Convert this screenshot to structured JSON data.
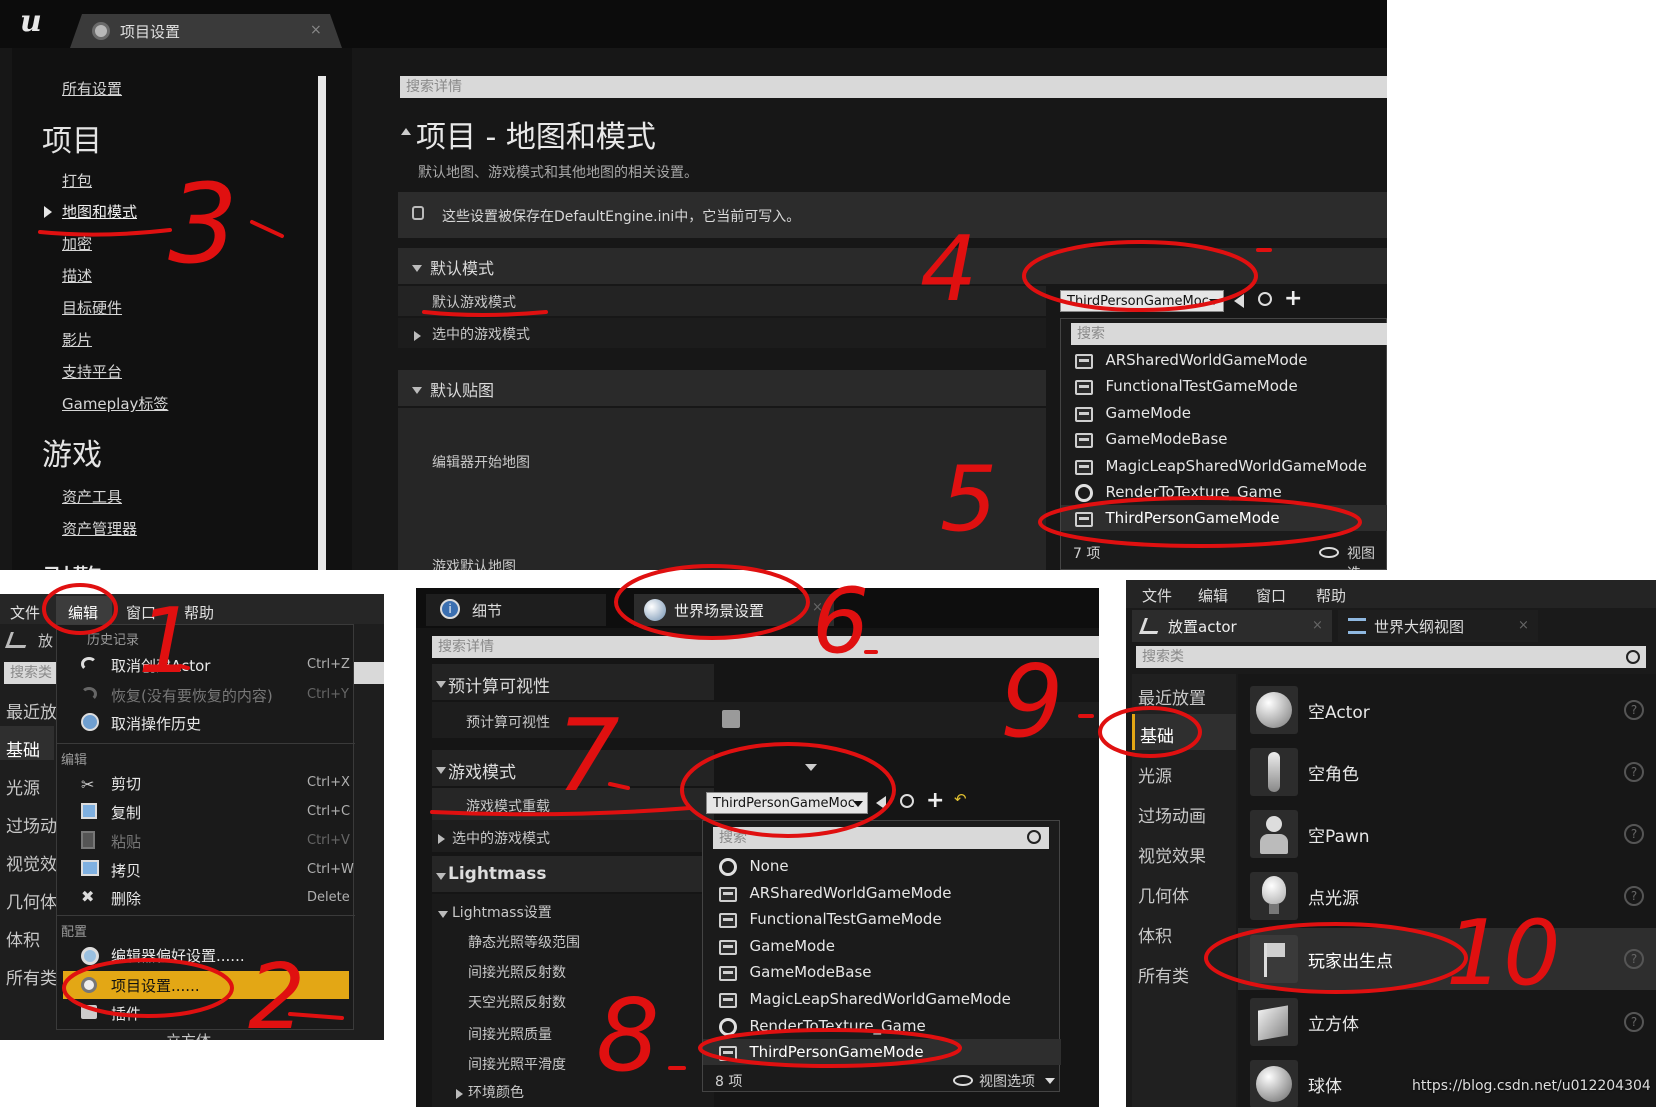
{
  "settings": {
    "logo": "ue-logo",
    "tab_title": "项目设置",
    "tab_close": "×",
    "search_placeholder": "搜索详情",
    "sidebar": {
      "all_settings": "所有设置",
      "section_project": "项目",
      "project_items": [
        "打包",
        "地图和模式",
        "加密",
        "描述",
        "目标硬件",
        "影片",
        "支持平台",
        "Gameplay标签"
      ],
      "section_game": "游戏",
      "game_items": [
        "资产工具",
        "资产管理器"
      ],
      "section_engine_partial": "引擎"
    },
    "page_title": "项目 - 地图和模式",
    "page_desc": "默认地图、游戏模式和其他地图的相关设置。",
    "notice": "这些设置被保存在DefaultEngine.ini中，它当前可写入。",
    "group_default_modes": "默认模式",
    "default_game_mode_label": "默认游戏模式",
    "selected_game_mode_label": "选中的游戏模式",
    "group_default_maps": "默认贴图",
    "editor_startup_map_label": "编辑器开始地图",
    "game_default_map_label": "游戏默认地图",
    "combo_value": "ThirdPersonGameMoc",
    "dropdown_search": "搜索",
    "dropdown_items": [
      "ARSharedWorldGameMode",
      "FunctionalTestGameMode",
      "GameMode",
      "GameModeBase",
      "MagicLeapSharedWorldGameMode",
      "RenderToTexture_Game",
      "ThirdPersonGameMode"
    ],
    "dropdown_count": "7 项",
    "view_options_partial": "视图选"
  },
  "edit_menu": {
    "menubar": [
      "文件",
      "编辑",
      "窗口",
      "帮助"
    ],
    "left_partial": [
      "放",
      "搜索类",
      "最近放",
      "基础",
      "光源",
      "过场动",
      "视觉效",
      "几何体",
      "体积",
      "所有类"
    ],
    "history_header": "历史记录",
    "history_items": [
      {
        "label": "取消创建Actor",
        "shortcut": "Ctrl+Z",
        "enabled": true
      },
      {
        "label": "恢复(没有要恢复的内容)",
        "shortcut": "Ctrl+Y",
        "enabled": false
      },
      {
        "label": "取消操作历史",
        "shortcut": "",
        "enabled": true
      }
    ],
    "edit_header": "编辑",
    "edit_items": [
      {
        "label": "剪切",
        "shortcut": "Ctrl+X",
        "enabled": true
      },
      {
        "label": "复制",
        "shortcut": "Ctrl+C",
        "enabled": true
      },
      {
        "label": "粘贴",
        "shortcut": "Ctrl+V",
        "enabled": false
      },
      {
        "label": "拷贝",
        "shortcut": "Ctrl+W",
        "enabled": true
      },
      {
        "label": "删除",
        "shortcut": "Delete",
        "enabled": true
      }
    ],
    "config_header": "配置",
    "config_items": [
      {
        "label": "编辑器偏好设置......",
        "highlighted": false
      },
      {
        "label": "项目设置......",
        "highlighted": true
      },
      {
        "label": "插件",
        "highlighted": false
      }
    ],
    "bottom_partial": "立方体",
    "highlight_color": "#e3a715"
  },
  "world": {
    "tab_details": "细节",
    "tab_world_settings": "世界场景设置",
    "search_placeholder": "搜索详情",
    "group_precomputed": "预计算可视性",
    "precomputed_label": "预计算可视性",
    "group_game_mode": "游戏模式",
    "override_label": "游戏模式重载",
    "selected_mode_label": "选中的游戏模式",
    "group_lightmass": "Lightmass",
    "lightmass_settings": "Lightmass设置",
    "lightmass_items": [
      "静态光照等级范围",
      "间接光照反射数",
      "天空光照反射数",
      "间接光照质量",
      "间接光照平滑度"
    ],
    "env_color": "环境颜色",
    "combo_value": "ThirdPersonGameMoc",
    "dropdown_search": "搜索",
    "dropdown_items": [
      {
        "label": "None",
        "icon": "ring"
      },
      {
        "label": "ARSharedWorldGameMode",
        "icon": "gm"
      },
      {
        "label": "FunctionalTestGameMode",
        "icon": "gm"
      },
      {
        "label": "GameMode",
        "icon": "gm"
      },
      {
        "label": "GameModeBase",
        "icon": "gm"
      },
      {
        "label": "MagicLeapSharedWorldGameMode",
        "icon": "gm"
      },
      {
        "label": "RenderToTexture_Game",
        "icon": "ring"
      },
      {
        "label": "ThirdPersonGameMode",
        "icon": "gm"
      }
    ],
    "dropdown_count": "8 项",
    "view_options": "视图选项"
  },
  "place": {
    "menubar": [
      "文件",
      "编辑",
      "窗口",
      "帮助"
    ],
    "tab_place_actor": "放置actor",
    "tab_outliner": "世界大纲视图",
    "search_placeholder": "搜索类",
    "categories": [
      "最近放置",
      "基础",
      "光源",
      "过场动画",
      "视觉效果",
      "几何体",
      "体积",
      "所有类"
    ],
    "actors": [
      "空Actor",
      "空角色",
      "空Pawn",
      "点光源",
      "玩家出生点",
      "立方体",
      "球体"
    ],
    "help_glyph": "?"
  },
  "annotations": {
    "numbers": [
      "1",
      "2",
      "3",
      "4",
      "5",
      "6",
      "7",
      "8",
      "9",
      "10"
    ],
    "color": "#e01010"
  },
  "watermark": "https://blog.csdn.net/u012204304"
}
